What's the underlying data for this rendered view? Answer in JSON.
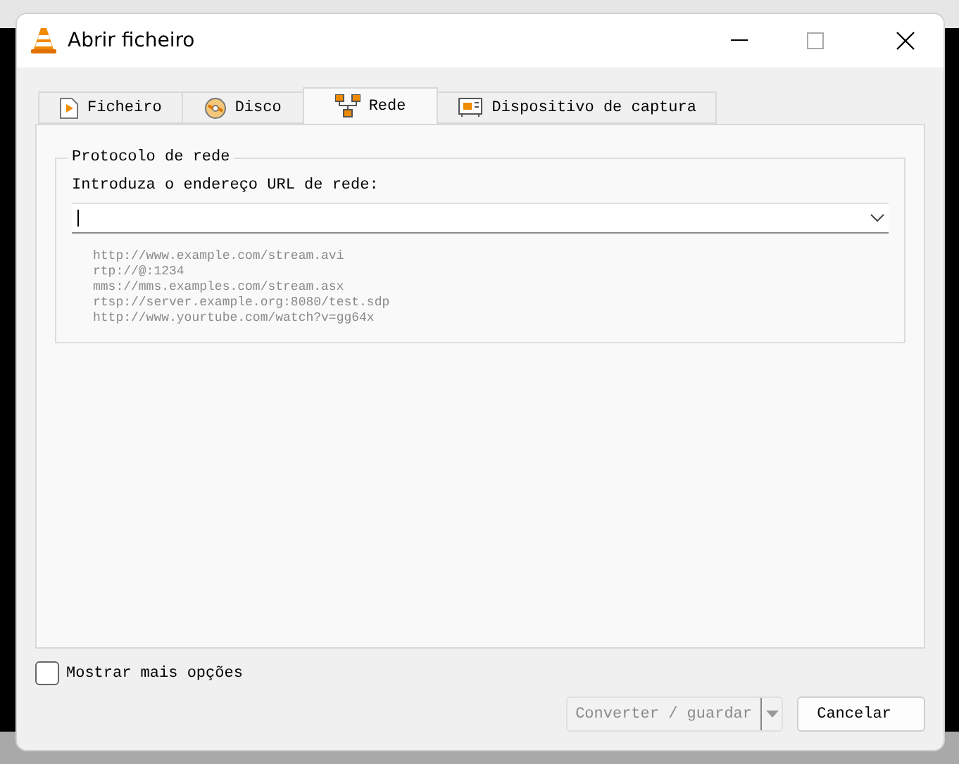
{
  "window": {
    "title": "Abrir ficheiro"
  },
  "tabs": [
    {
      "label": "Ficheiro",
      "kind": "file",
      "selected": false
    },
    {
      "label": "Disco",
      "kind": "disc",
      "selected": false
    },
    {
      "label": "Rede",
      "kind": "network",
      "selected": true
    },
    {
      "label": "Dispositivo de captura",
      "kind": "capture",
      "selected": false
    }
  ],
  "group": {
    "title": "Protocolo de rede",
    "label": "Introduza o endereço URL de rede:",
    "examples": [
      "http://www.example.com/stream.avi",
      "rtp://@:1234",
      "mms://mms.examples.com/stream.asx",
      "rtsp://server.example.org:8080/test.sdp",
      "http://www.yourtube.com/watch?v=gg64x"
    ]
  },
  "more_options": {
    "label": "Mostrar mais opções",
    "checked": false
  },
  "buttons": [
    {
      "label": "Converter / guardar",
      "kind": "split",
      "disabled": true
    },
    {
      "label": "Cancelar",
      "kind": "plain",
      "disabled": false
    }
  ]
}
